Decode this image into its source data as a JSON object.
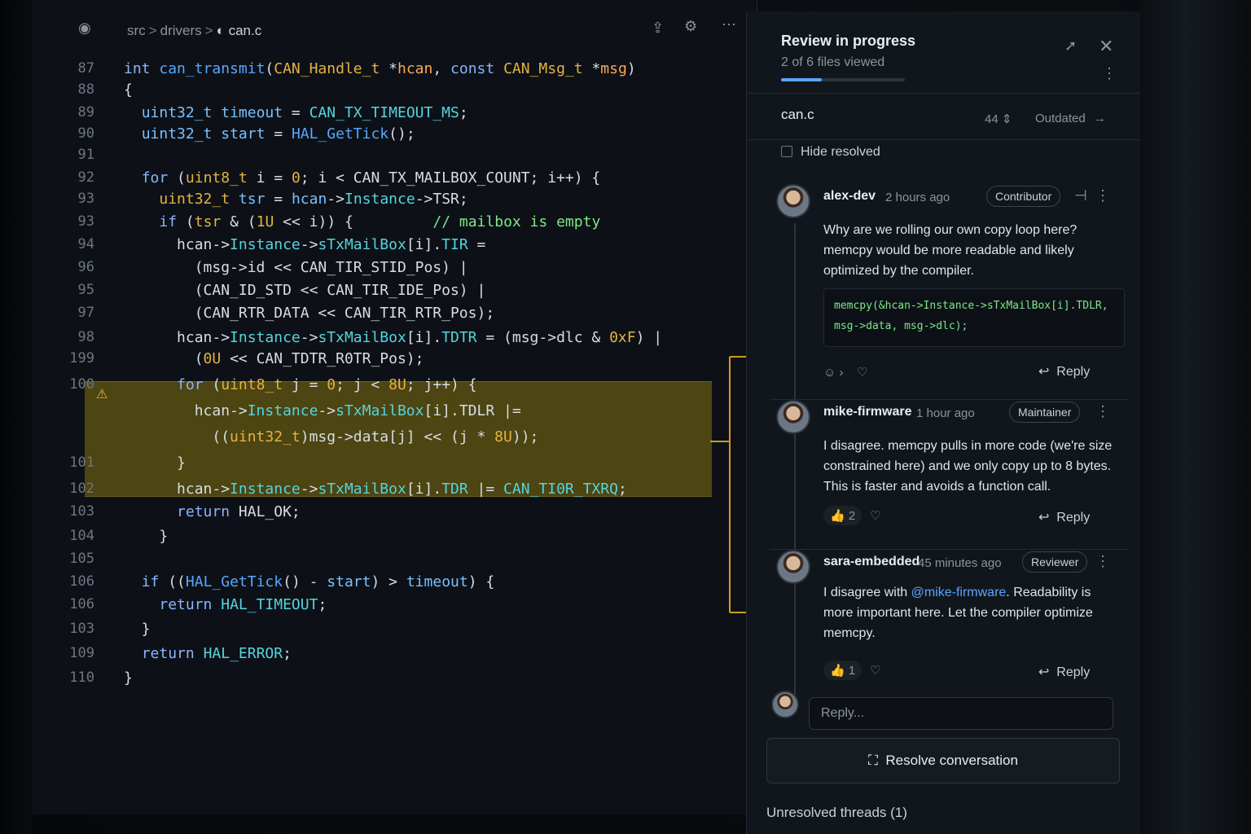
{
  "editor": {
    "breadcrumb": [
      "src",
      "drivers",
      "can.c"
    ],
    "lines": [
      {
        "n": "87",
        "html": "<span class=\"kw\">int</span> <span class=\"fn\">can_transmit</span>(<span class=\"nm\">CAN_Handle_t</span> *<span class=\"pt\">hcan</span>, <span class=\"kw\">const</span> <span class=\"nm\">CAN_Msg_t</span> *<span class=\"pt\">msg</span>)"
      },
      {
        "n": "88",
        "html": "{"
      },
      {
        "n": "89",
        "html": "  <span class=\"ty\">uint32_t</span> <span class=\"ty\">timeout</span> = <span class=\"mb\">CAN_TX_TIMEOUT_MS</span>;"
      },
      {
        "n": "90",
        "html": "  <span class=\"ty\">uint32_t</span> <span class=\"ty\">start</span> = <span class=\"fn\">HAL_GetTick</span>();"
      },
      {
        "n": "91",
        "html": ""
      },
      {
        "n": "92",
        "html": "  <span class=\"kw\">for</span> (<span class=\"nm\">uint8_t</span> i = <span class=\"nm\">0</span>; i &lt; CAN_TX_MAILBOX_COUNT; i++) {"
      },
      {
        "n": "93",
        "html": "    <span class=\"nm\">uint32_t</span> <span class=\"ty\">tsr</span> = <span class=\"ty\">hcan</span>-&gt;<span class=\"mb\">Instance</span>-&gt;TSR;"
      },
      {
        "n": "93",
        "html": "    <span class=\"kw\">if</span> (<span class=\"nm\">tsr</span> &amp; (<span class=\"nm\">1U</span> &lt;&lt; i)) {         <span class=\"cm\">// mailbox is empty</span>"
      },
      {
        "n": "94",
        "html": "      hcan-&gt;<span class=\"mb\">Instance</span>-&gt;<span class=\"mb\">sTxMailBox</span>[i].<span class=\"mb\">TIR</span> ="
      },
      {
        "n": "96",
        "html": "        (msg-&gt;id &lt;&lt; CAN_TIR_STID_Pos) |"
      },
      {
        "n": "95",
        "html": "        (CAN_ID_STD &lt;&lt; CAN_TIR_IDE_Pos) |"
      },
      {
        "n": "97",
        "html": "        (CAN_RTR_DATA &lt;&lt; CAN_TIR_RTR_Pos);"
      },
      {
        "n": "98",
        "html": "      hcan-&gt;<span class=\"mb\">Instance</span>-&gt;<span class=\"mb\">sTxMailBox</span>[i].<span class=\"mb\">TDTR</span> = (msg-&gt;dlc &amp; <span class=\"nm\">0xF</span>) |"
      },
      {
        "n": "199",
        "html": "        (<span class=\"nm\">0U</span> &lt;&lt; CAN_TDTR_R0TR_Pos);"
      },
      {
        "n": "100",
        "html": "      <span class=\"kw\">for</span> (<span class=\"nm\">uint8_t</span> j = <span class=\"nm\">0</span>; j &lt; <span class=\"nm\">8U</span>; j++) {"
      },
      {
        "n": "",
        "html": "        hcan-&gt;<span class=\"mb\">Instance</span>-&gt;<span class=\"mb\">sTxMailBox</span>[i].TDLR |="
      },
      {
        "n": "",
        "html": "          ((<span class=\"nm\">uint32_t</span>)msg-&gt;data[j] &lt;&lt; (j * <span class=\"nm\">8U</span>));"
      },
      {
        "n": "101",
        "html": "      }"
      },
      {
        "n": "102",
        "html": "      hcan-&gt;<span class=\"mb\">Instance</span>-&gt;<span class=\"mb\">sTxMailBox</span>[i].<span class=\"mb\">TDR</span> |= <span class=\"mb\">CAN_TI0R_TXRQ</span>;"
      },
      {
        "n": "103",
        "html": "      <span class=\"kw\">return</span> HAL_OK;"
      },
      {
        "n": "104",
        "html": "    }"
      },
      {
        "n": "105",
        "html": ""
      },
      {
        "n": "106",
        "html": "  <span class=\"kw\">if</span> ((<span class=\"fn\">HAL_GetTick</span>() - <span class=\"ty\">start</span>) &gt; <span class=\"ty\">timeout</span>) {"
      },
      {
        "n": "106",
        "html": "    <span class=\"kw\">return</span> <span class=\"mb\">HAL_TIMEOUT</span>;"
      },
      {
        "n": "103",
        "html": "  }"
      },
      {
        "n": "109",
        "html": "  <span class=\"kw\">return</span> <span class=\"mb\">HAL_ERROR</span>;"
      },
      {
        "n": "110",
        "html": "}"
      }
    ]
  },
  "panel": {
    "title": "Review in progress",
    "subtitle": "2 of 6 files viewed",
    "progress_fraction": 0.33,
    "file": {
      "name": "can.c",
      "count": "44",
      "status": "Outdated"
    },
    "hide_resolved": "Hide resolved",
    "comments": [
      {
        "author": "alex-dev",
        "time": "2 hours ago",
        "role": "Contributor",
        "text": "Why are we rolling our own copy loop here? memcpy would be more readable and likely optimized by the compiler.",
        "code": "memcpy(&hcan->Instance->sTxMailBox[i].TDLR,\nmsg->data, msg->dlc);",
        "reaction_count": "",
        "reply": "Reply"
      },
      {
        "author": "mike-firmware",
        "time": "1 hour ago",
        "role": "Maintainer",
        "text": "I disagree. memcpy pulls in more code (we're size constrained here) and we only copy up to 8 bytes. This is faster and avoids a function call.",
        "reaction_count": "2",
        "reply": "Reply"
      },
      {
        "author": "sara-embedded",
        "time": "45 minutes ago",
        "role": "Reviewer",
        "text_pre": "I disagree with ",
        "mention": "@mike-firmware",
        "text_post": ". Readability is more important here. Let the compiler optimize memcpy.",
        "reaction_count": "1",
        "reply": "Reply"
      }
    ],
    "reply_placeholder": "Reply...",
    "resolve_label": "Resolve conversation",
    "unresolved_label": "Unresolved threads (1)"
  },
  "colors": {
    "accent": "#58a6ff",
    "highlight": "#4d4512",
    "warning": "#e3b341",
    "connector": "#d29922"
  }
}
